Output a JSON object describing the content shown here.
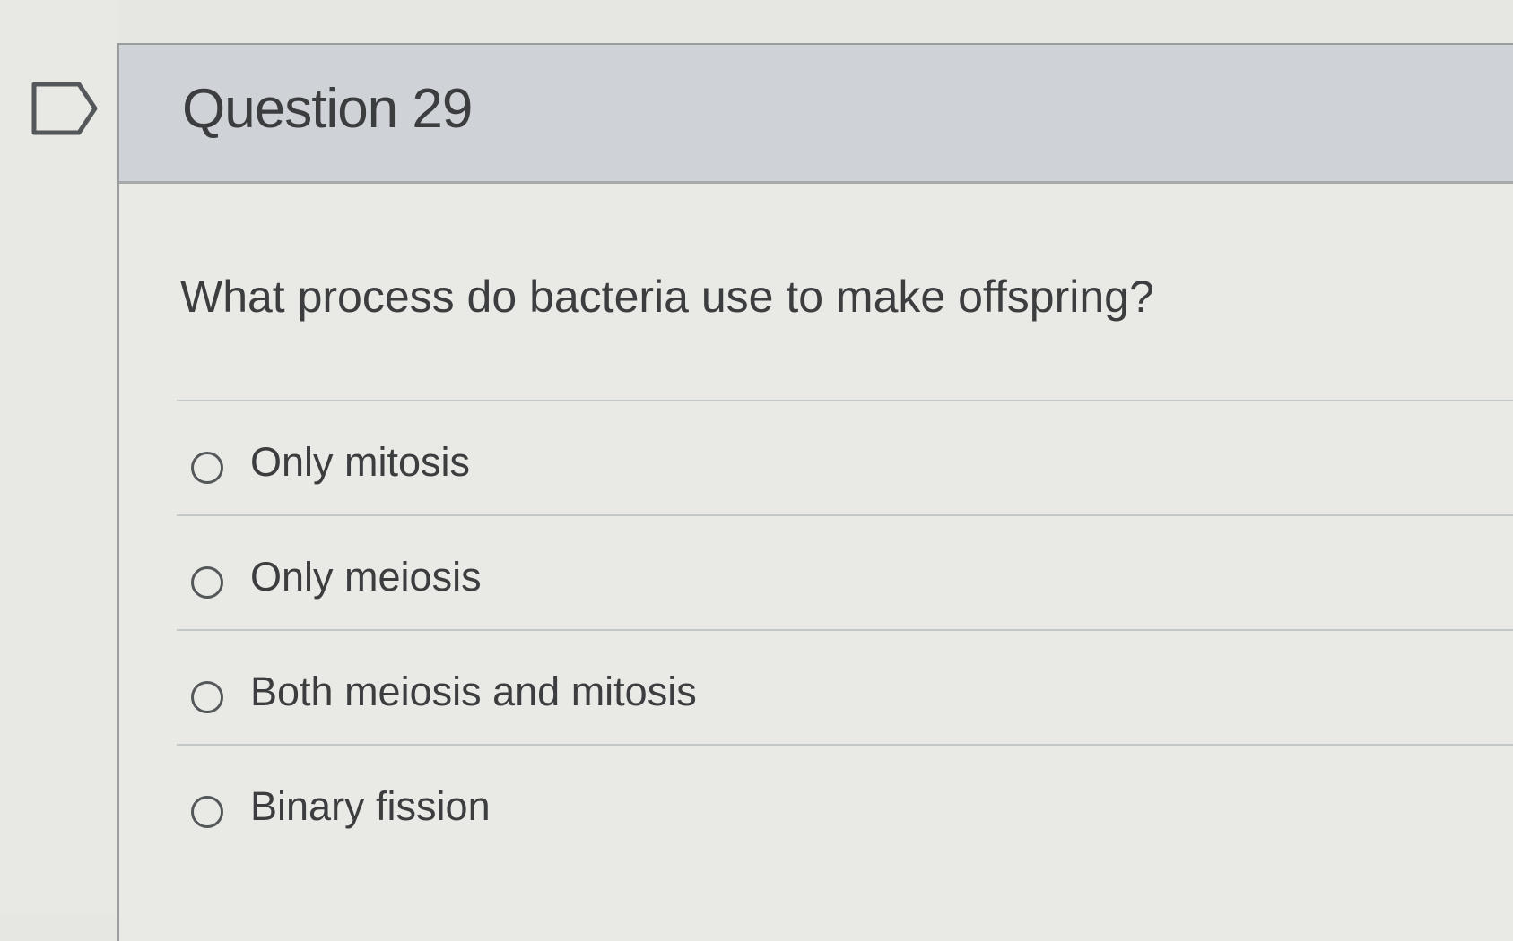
{
  "header": {
    "title": "Question 29",
    "flag_icon": "flag-outline-icon"
  },
  "question": {
    "prompt": "What process do bacteria use to make offspring?"
  },
  "answers": [
    {
      "label": "Only mitosis",
      "selected": false
    },
    {
      "label": "Only meiosis",
      "selected": false
    },
    {
      "label": "Both meiosis and mitosis",
      "selected": false
    },
    {
      "label": "Binary fission",
      "selected": false
    }
  ],
  "colors": {
    "header_bg": "#cfd3d8",
    "page_bg": "#e6e7e2",
    "text": "#3b3d3f"
  }
}
